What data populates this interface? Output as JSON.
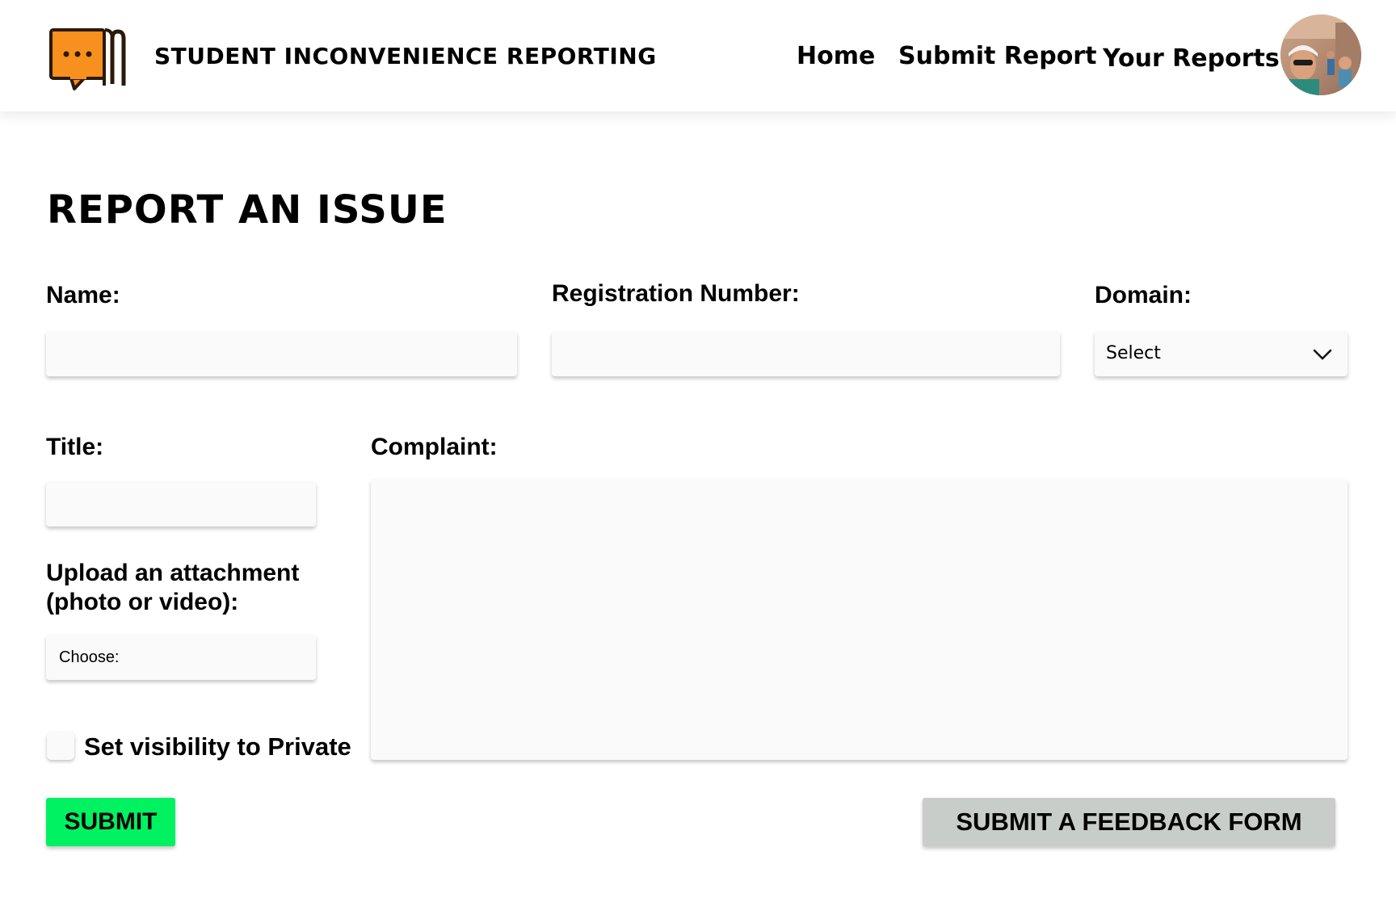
{
  "header": {
    "brand_title": "STUDENT INCONVENIENCE REPORTING",
    "logo_icon": "speech-bubble-book-icon",
    "nav": {
      "home": "Home",
      "submit_report": "Submit Report",
      "your_reports": "Your Reports"
    },
    "avatar_icon": "user-avatar-photo"
  },
  "page": {
    "title": "REPORT AN ISSUE"
  },
  "form": {
    "name_label": "Name:",
    "name_value": "",
    "registration_label": "Registration Number:",
    "registration_value": "",
    "domain_label": "Domain:",
    "domain_selected": "Select",
    "title_label": "Title:",
    "title_value": "",
    "complaint_label": "Complaint:",
    "complaint_value": "",
    "upload_label": "Upload an attachment (photo or video):",
    "upload_choose": "Choose:",
    "private_label": "Set visibility to Private",
    "private_checked": false
  },
  "actions": {
    "submit_label": "SUBMIT",
    "feedback_label": "SUBMIT A FEEDBACK FORM"
  },
  "colors": {
    "accent_orange": "#f7901e",
    "submit_green": "#00f260",
    "feedback_gray": "#c8cdc9",
    "field_bg": "#fafafa"
  }
}
